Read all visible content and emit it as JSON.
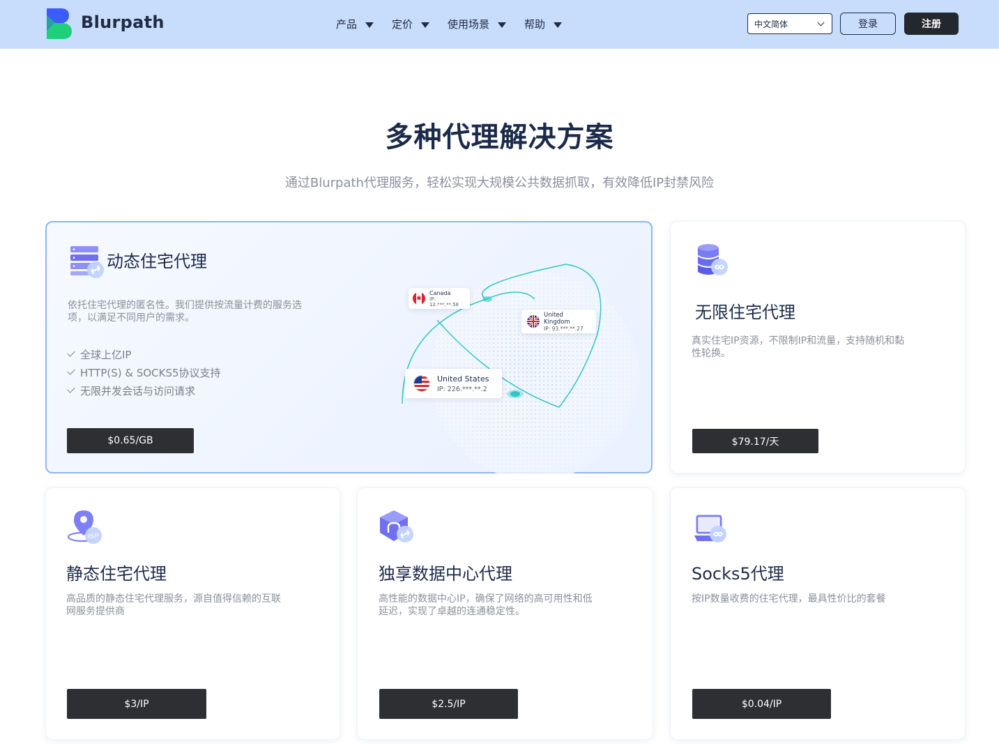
{
  "header": {
    "brand": "Blurpath",
    "nav": [
      {
        "label": "产品"
      },
      {
        "label": "定价"
      },
      {
        "label": "使用场景"
      },
      {
        "label": "帮助"
      }
    ],
    "language": "中文简体",
    "login_label": "登录",
    "register_label": "注册"
  },
  "hero": {
    "title": "多种代理解决方案",
    "subtitle": "通过Blurpath代理服务，轻松实现大规模公共数据抓取，有效降低IP封禁风险"
  },
  "cards": {
    "dynamic": {
      "title": "动态住宅代理",
      "desc_line1": "依托住宅代理的匿名性。我们提供按流量计费的服务选",
      "desc_line2": "项，以满足不同用户的需求。",
      "features": [
        "全球上亿IP",
        "HTTP(S) & SOCKS5协议支持",
        "无限并发会话与访问请求"
      ],
      "price": "$0.65/GB",
      "locations": [
        {
          "name": "Canada",
          "ip": "IP: 12.***.**.58"
        },
        {
          "name": "United Kingdom",
          "ip": "IP: 93.***.**.27"
        },
        {
          "name": "United States",
          "ip": "IP: 226.***.**.2"
        }
      ]
    },
    "unlimited": {
      "title": "无限住宅代理",
      "desc_line1": "真实住宅IP资源，不限制IP和流量，支持随机和黏",
      "desc_line2": "性轮换。",
      "price": "$79.17/天"
    },
    "static": {
      "title": "静态住宅代理",
      "desc_line1": "高品质的静态住宅代理服务，源自值得信赖的互联",
      "desc_line2": "网服务提供商",
      "icon_text": "ISP",
      "price": "$3/IP"
    },
    "datacenter": {
      "title": "独享数据中心代理",
      "desc_line1": "高性能的数据中心IP，确保了网络的高可用性和低",
      "desc_line2": "延迟，实现了卓越的连通稳定性。",
      "price": "$2.5/IP"
    },
    "socks5": {
      "title": "Socks5代理",
      "desc_line1": "按IP数量收费的住宅代理，最具性价比的套餐",
      "desc_line2": "",
      "price": "$0.04/IP"
    }
  },
  "colors": {
    "header_bg": "#c8dcfb",
    "brand_blue": "#3b5bfd",
    "brand_green": "#1ed07a",
    "dark_button": "#2e2f33",
    "featured_border": "#8fb5f2",
    "icon_purple": "#7d7ff7",
    "teal": "#2fc6c6"
  },
  "icons": [
    "logo",
    "caret-down-icon",
    "chevron-down-icon",
    "server-link-icon",
    "database-infinity-icon",
    "location-isp-icon",
    "datacenter-link-icon",
    "laptop-infinity-icon",
    "check-icon",
    "canada-flag-icon",
    "uk-flag-icon",
    "us-flag-icon",
    "globe-illustration"
  ]
}
